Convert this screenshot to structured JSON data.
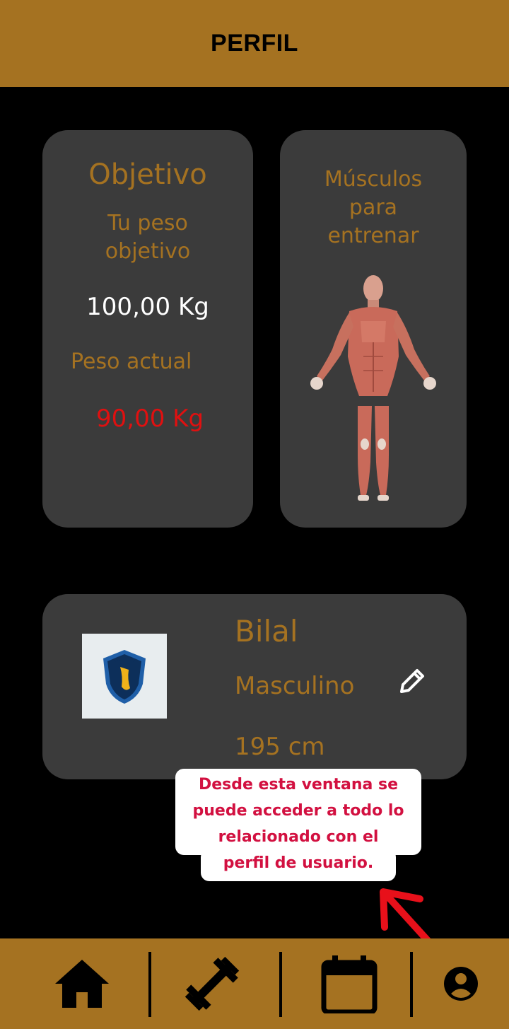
{
  "header": {
    "title": "PERFIL"
  },
  "objetivo_card": {
    "title": "Objetivo",
    "subtitle_line1": "Tu peso",
    "subtitle_line2": "objetivo",
    "goal_weight": "100,00 Kg",
    "current_label": "Peso actual",
    "current_weight": "90,00 Kg"
  },
  "musculos_card": {
    "title_line1": "Músculos",
    "title_line2": "para",
    "title_line3": "entrenar",
    "image_icon": "muscle-anatomy-figure"
  },
  "profile_card": {
    "name": "Bilal",
    "gender": "Masculino",
    "height": "195 cm",
    "avatar_icon": "deer-shield-logo",
    "edit_icon": "pencil-icon"
  },
  "callout": {
    "line1": "Desde esta ventana se",
    "line2": "puede acceder a todo lo",
    "line3": "relacionado con el",
    "line4": "perfil de usuario."
  },
  "bottom_nav": [
    {
      "icon": "home-icon"
    },
    {
      "icon": "dumbbell-icon"
    },
    {
      "icon": "calendar-icon"
    },
    {
      "icon": "account-circle-icon"
    }
  ],
  "colors": {
    "accent": "#A57221",
    "card_bg": "#3b3b3b",
    "background": "#000000",
    "current_weight": "#E01010",
    "callout_text": "#D21040",
    "arrow": "#E8101A"
  }
}
